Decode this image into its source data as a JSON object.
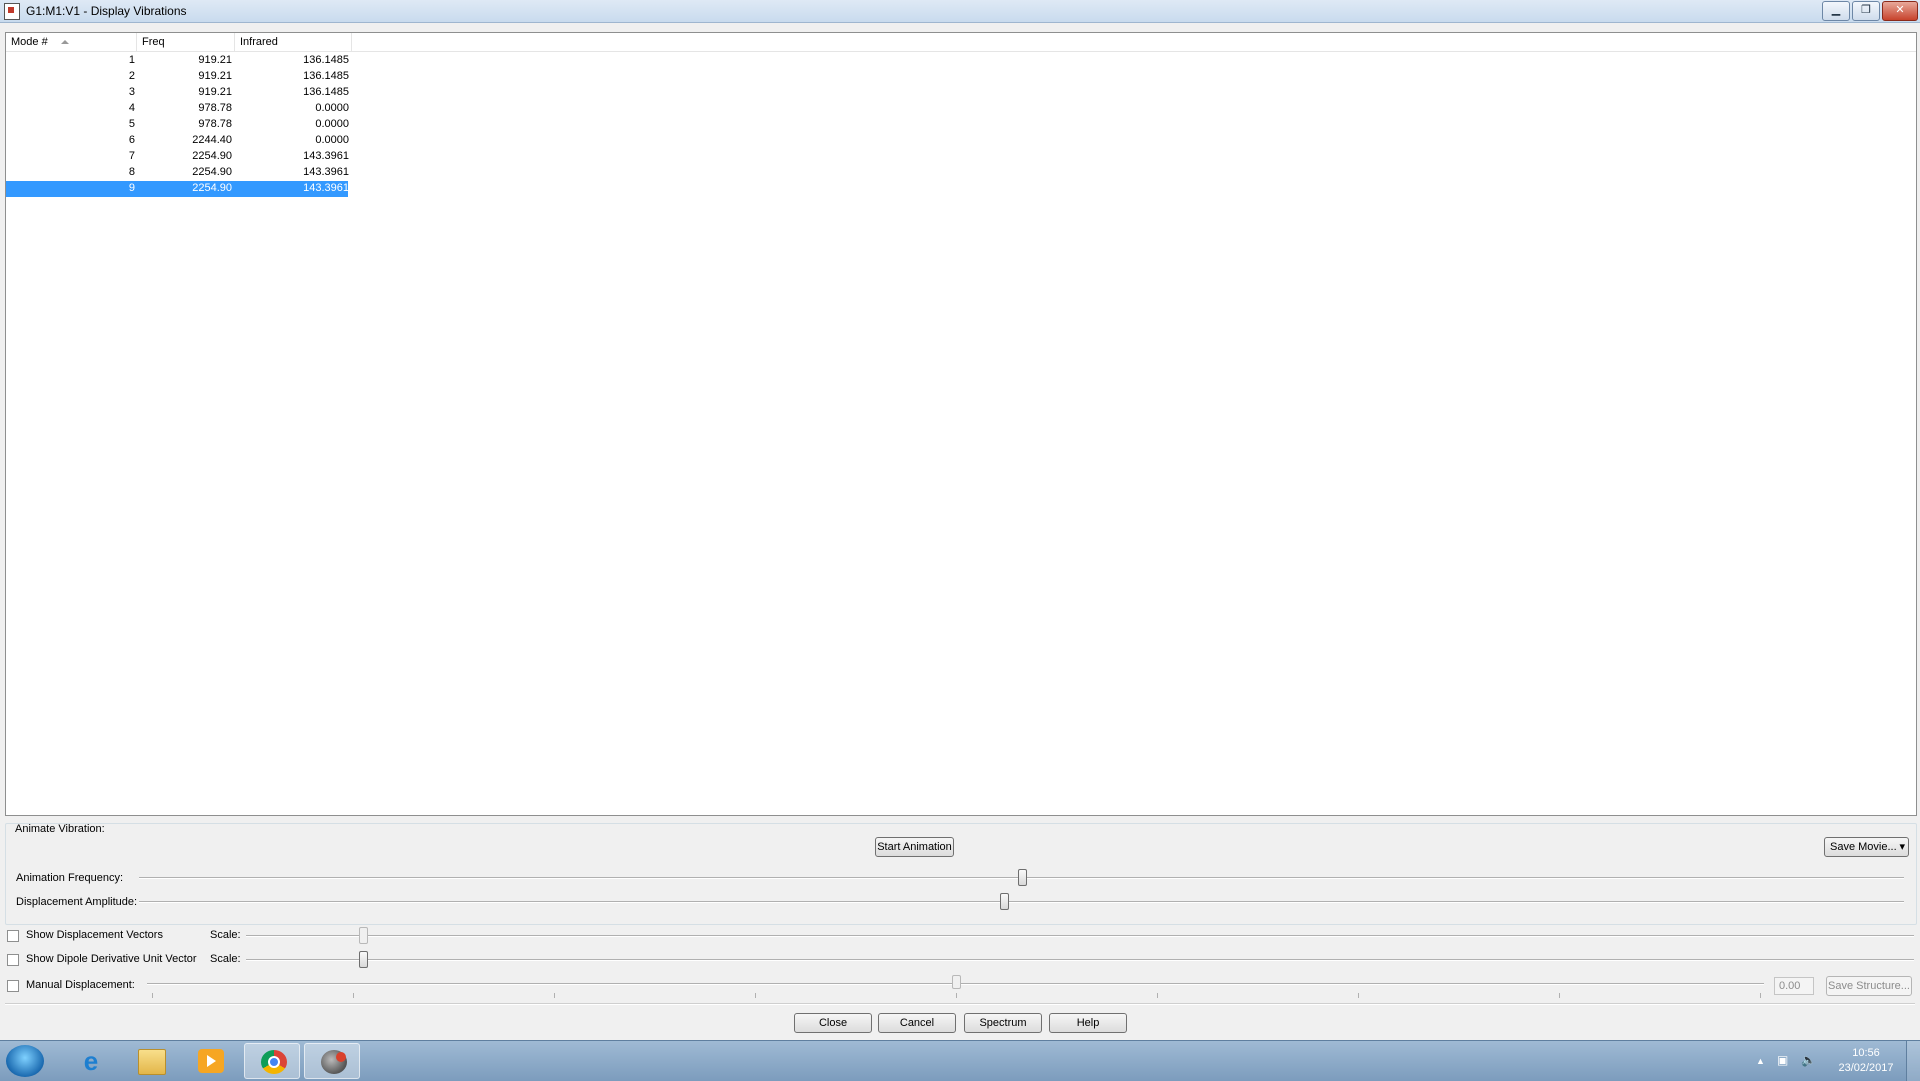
{
  "window": {
    "title": "G1:M1:V1 - Display Vibrations",
    "min_glyph": "▁",
    "max_glyph": "❐",
    "close_glyph": "✕"
  },
  "table": {
    "headers": [
      "Mode #",
      "Freq",
      "Infrared"
    ],
    "rows": [
      {
        "mode": "1",
        "freq": "919.21",
        "ir": "136.1485"
      },
      {
        "mode": "2",
        "freq": "919.21",
        "ir": "136.1485"
      },
      {
        "mode": "3",
        "freq": "919.21",
        "ir": "136.1485"
      },
      {
        "mode": "4",
        "freq": "978.78",
        "ir": "0.0000"
      },
      {
        "mode": "5",
        "freq": "978.78",
        "ir": "0.0000"
      },
      {
        "mode": "6",
        "freq": "2244.40",
        "ir": "0.0000"
      },
      {
        "mode": "7",
        "freq": "2254.90",
        "ir": "143.3961"
      },
      {
        "mode": "8",
        "freq": "2254.90",
        "ir": "143.3961"
      },
      {
        "mode": "9",
        "freq": "2254.90",
        "ir": "143.3961"
      }
    ],
    "selected_mode": "9"
  },
  "animate": {
    "group_label": "Animate Vibration:",
    "start_label": "Start Animation",
    "save_movie_label": "Save Movie...",
    "save_movie_arrow": "▾",
    "frequency_label": "Animation Frequency:",
    "frequency_level": 0.5,
    "amplitude_label": "Displacement Amplitude:",
    "amplitude_level": 0.49
  },
  "options": {
    "show_vectors_label": "Show Displacement Vectors",
    "show_vectors_checked": false,
    "vectors_scale_label": "Scale:",
    "vectors_scale_level": 0.07,
    "show_dipole_label": "Show Dipole Derivative Unit Vector",
    "show_dipole_checked": false,
    "dipole_scale_label": "Scale:",
    "dipole_scale_level": 0.07,
    "manual_label": "Manual Displacement:",
    "manual_checked": false,
    "manual_level": 0.5,
    "manual_value": "0.00",
    "save_structure_label": "Save Structure..."
  },
  "buttons": {
    "close": "Close",
    "cancel": "Cancel",
    "spectrum": "Spectrum",
    "help": "Help"
  },
  "taskbar": {
    "tray_arrow": "▲",
    "network_glyph": "▣",
    "volume_glyph": "🔈",
    "time": "10:56",
    "date": "23/02/2017"
  }
}
